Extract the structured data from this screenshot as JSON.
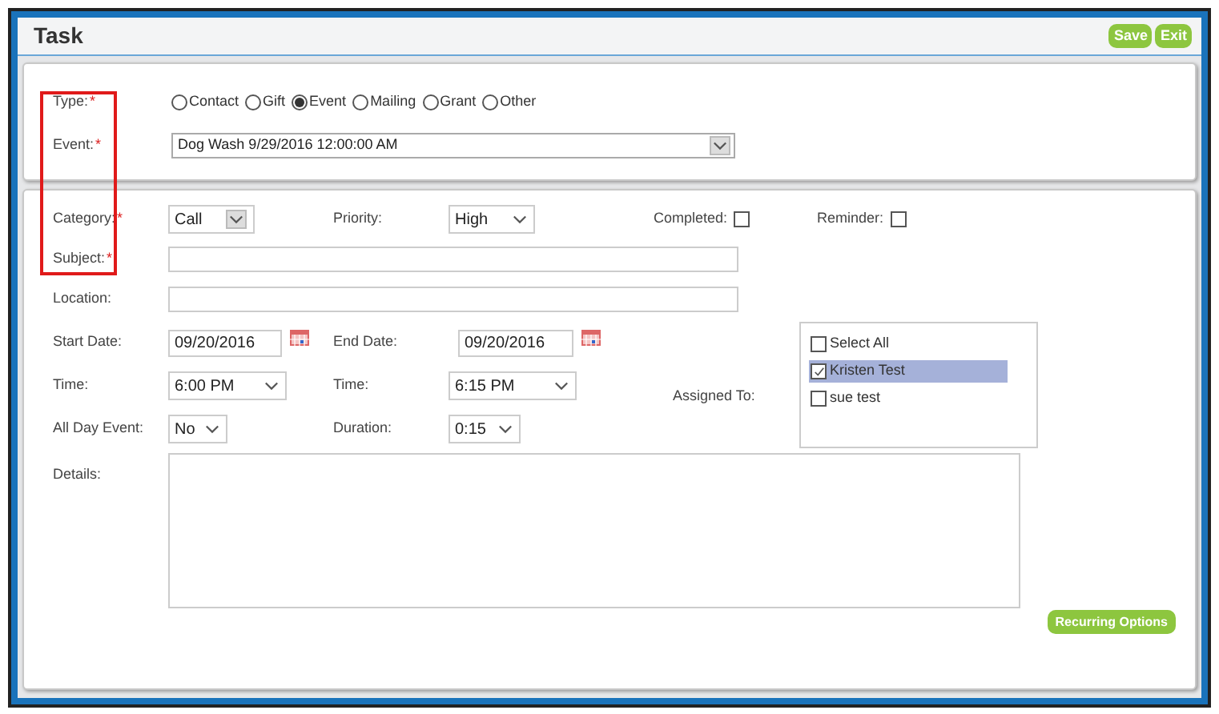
{
  "window": {
    "title": "Task"
  },
  "header_buttons": [
    {
      "label": "Save"
    },
    {
      "label": "Exit"
    }
  ],
  "type": {
    "label": "Type:",
    "mark": "*",
    "options": [
      {
        "label": "Contact",
        "selected": false
      },
      {
        "label": "Gift",
        "selected": false
      },
      {
        "label": "Event",
        "selected": true
      },
      {
        "label": "Mailing",
        "selected": false
      },
      {
        "label": "Grant",
        "selected": false
      },
      {
        "label": "Other",
        "selected": false
      }
    ]
  },
  "event": {
    "label": "Event:",
    "mark": "*",
    "value": "Dog Wash 9/29/2016 12:00:00 AM"
  },
  "category": {
    "label": "Category:",
    "mark": "*",
    "value": "Call"
  },
  "priority": {
    "label": "Priority:",
    "value": "High"
  },
  "completed": {
    "label": "Completed:",
    "checked": false
  },
  "reminder": {
    "label": "Reminder:",
    "checked": false
  },
  "subject": {
    "label": "Subject:",
    "mark": "*"
  },
  "location": {
    "label": "Location:"
  },
  "start_date": {
    "label": "Start Date:",
    "value": "09/20/2016"
  },
  "end_date": {
    "label": "End Date:",
    "value": "09/20/2016"
  },
  "start_time": {
    "label": "Time:",
    "value": "6:00 PM"
  },
  "end_time": {
    "label": "Time:",
    "value": "6:15 PM"
  },
  "all_day": {
    "label": "All Day Event:",
    "value": "No"
  },
  "duration": {
    "label": "Duration:",
    "value": "0:15"
  },
  "assigned_to": {
    "label": "Assigned To:",
    "items": [
      {
        "label": "Select All",
        "checked": false,
        "selected": false
      },
      {
        "label": "Kristen Test",
        "checked": true,
        "selected": true
      },
      {
        "label": "sue test",
        "checked": false,
        "selected": false
      }
    ]
  },
  "details": {
    "label": "Details:"
  },
  "recurring_button": {
    "label": "Recurring Options"
  }
}
